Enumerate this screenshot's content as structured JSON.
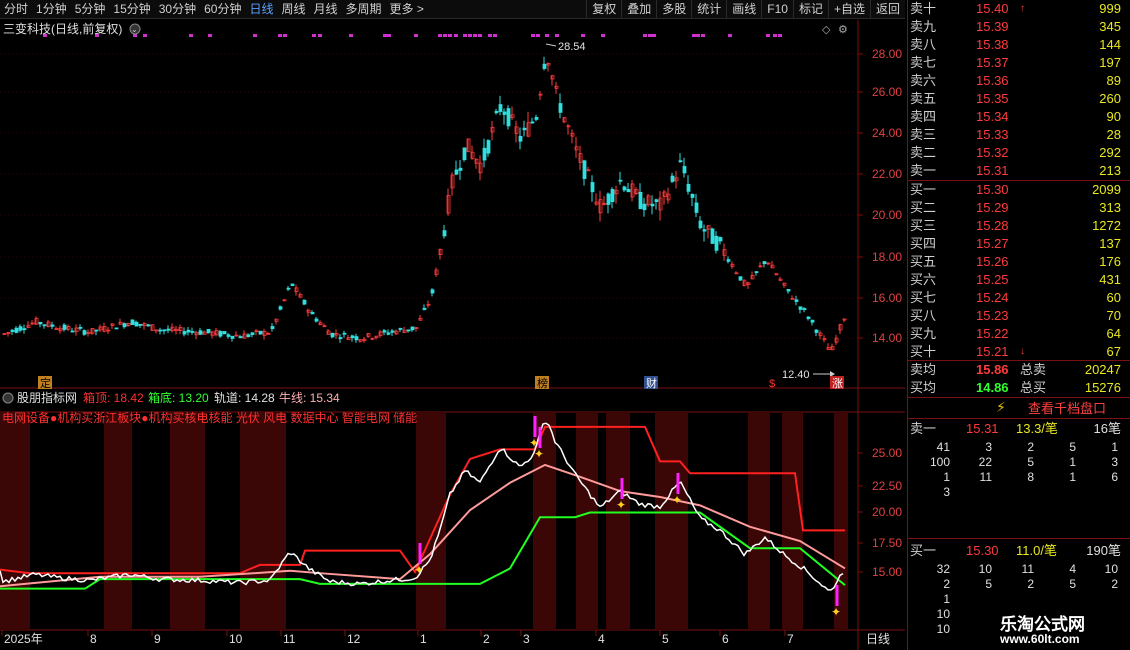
{
  "toolbar": {
    "periods": [
      "分时",
      "1分钟",
      "5分钟",
      "15分钟",
      "30分钟",
      "60分钟",
      "日线",
      "周线",
      "月线",
      "多周期",
      "更多 >"
    ],
    "active_period": "日线",
    "buttons": [
      "复权",
      "叠加",
      "多股",
      "统计",
      "画线",
      "F10",
      "标记",
      "+自选",
      "返回"
    ]
  },
  "main_chart": {
    "title": "三变科技(日线,前复权)",
    "y_ticks": [
      "28.00",
      "26.00",
      "24.00",
      "22.00",
      "20.00",
      "18.00",
      "16.00",
      "14.00"
    ],
    "high_label": "28.54",
    "low_label": "12.40",
    "markers": [
      "定",
      "榜",
      "财",
      "$",
      "涨"
    ]
  },
  "indicator": {
    "name": "股朋指标网",
    "box_top_label": "箱顶: 18.42",
    "box_bottom_label": "箱底: 13.20",
    "track_label": "轨道: 14.28",
    "bull_label": "牛线: 15.34",
    "concepts": "电网设备●机构买浙江板块●机构买核电核能 光伏 风电 数据中心 智能电网 储能",
    "y_ticks": [
      "25.00",
      "22.50",
      "20.00",
      "17.50",
      "15.00"
    ],
    "colors": {
      "box_top": "#ff2020",
      "box_bottom": "#20ff20",
      "bull": "#ff9a9a",
      "track": "#ffffff",
      "signal": "#ff20ff"
    }
  },
  "x_axis": {
    "labels": [
      "2025年",
      "8",
      "9",
      "10",
      "11",
      "12",
      "1",
      "2",
      "3",
      "4",
      "5",
      "6",
      "7"
    ],
    "period_tag": "日线"
  },
  "order_book": {
    "asks": [
      {
        "label": "卖十",
        "price": "15.40",
        "vol": "999",
        "arrow": "↑"
      },
      {
        "label": "卖九",
        "price": "15.39",
        "vol": "345"
      },
      {
        "label": "卖八",
        "price": "15.38",
        "vol": "144"
      },
      {
        "label": "卖七",
        "price": "15.37",
        "vol": "197"
      },
      {
        "label": "卖六",
        "price": "15.36",
        "vol": "89"
      },
      {
        "label": "卖五",
        "price": "15.35",
        "vol": "260"
      },
      {
        "label": "卖四",
        "price": "15.34",
        "vol": "90"
      },
      {
        "label": "卖三",
        "price": "15.33",
        "vol": "28"
      },
      {
        "label": "卖二",
        "price": "15.32",
        "vol": "292"
      },
      {
        "label": "卖一",
        "price": "15.31",
        "vol": "213"
      }
    ],
    "bids": [
      {
        "label": "买一",
        "price": "15.30",
        "vol": "2099"
      },
      {
        "label": "买二",
        "price": "15.29",
        "vol": "313"
      },
      {
        "label": "买三",
        "price": "15.28",
        "vol": "1272"
      },
      {
        "label": "买四",
        "price": "15.27",
        "vol": "137"
      },
      {
        "label": "买五",
        "price": "15.26",
        "vol": "176"
      },
      {
        "label": "买六",
        "price": "15.25",
        "vol": "431"
      },
      {
        "label": "买七",
        "price": "15.24",
        "vol": "60"
      },
      {
        "label": "买八",
        "price": "15.23",
        "vol": "70"
      },
      {
        "label": "买九",
        "price": "15.22",
        "vol": "64"
      },
      {
        "label": "买十",
        "price": "15.21",
        "vol": "67",
        "arrow": "↓"
      }
    ],
    "avg_sell_label": "卖均",
    "avg_sell": "15.86",
    "total_sell_label": "总卖",
    "total_sell": "20247",
    "avg_buy_label": "买均",
    "avg_buy": "14.86",
    "total_buy_label": "总买",
    "total_buy": "15276",
    "view_button": "查看千档盘口"
  },
  "queue": {
    "sell1": {
      "label": "卖一",
      "price": "15.31",
      "per": "13.3/笔",
      "count": "16笔"
    },
    "sell_grid": [
      [
        "41",
        "3",
        "2",
        "5",
        "1"
      ],
      [
        "100",
        "22",
        "5",
        "1",
        "3"
      ],
      [
        "1",
        "11",
        "8",
        "1",
        "6"
      ],
      [
        "3",
        "",
        "",
        "",
        ""
      ]
    ],
    "buy1": {
      "label": "买一",
      "price": "15.30",
      "per": "11.0/笔",
      "count": "190笔"
    },
    "buy_grid": [
      [
        "32",
        "10",
        "11",
        "4",
        "10"
      ],
      [
        "2",
        "5",
        "2",
        "5",
        "2"
      ],
      [
        "1",
        "",
        "",
        "",
        ""
      ],
      [
        "10",
        "",
        "",
        "",
        ""
      ],
      [
        "10",
        "",
        "",
        "",
        ""
      ]
    ]
  },
  "watermark": {
    "name": "乐淘公式网",
    "url": "www.60lt.com"
  }
}
